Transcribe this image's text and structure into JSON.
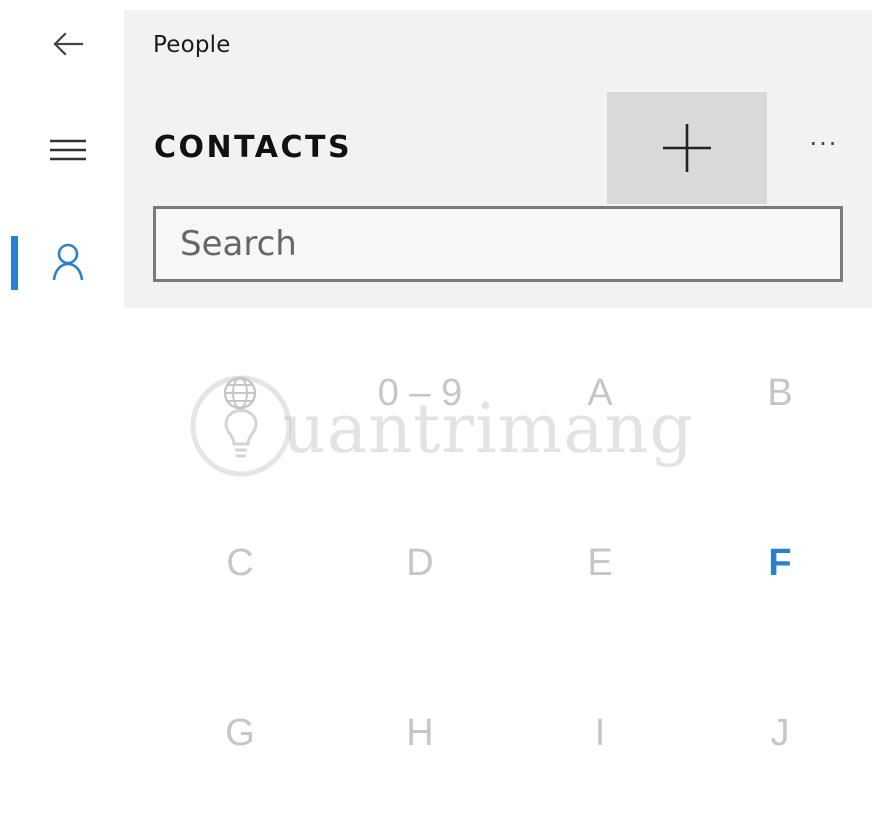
{
  "app": {
    "title": "People"
  },
  "rail": {
    "back_icon": "back-arrow-icon",
    "menu_icon": "hamburger-menu-icon",
    "people_icon": "person-icon",
    "accent_color": "#2b7fcf"
  },
  "header": {
    "section_title": "CONTACTS",
    "add_icon": "plus-icon",
    "more_label": "···"
  },
  "search": {
    "placeholder": "Search",
    "value": ""
  },
  "jump_list": {
    "letters": [
      {
        "label": "",
        "icon": "globe-icon",
        "active": false
      },
      {
        "label": "0 – 9",
        "active": false
      },
      {
        "label": "A",
        "active": false
      },
      {
        "label": "B",
        "active": false
      },
      {
        "label": "C",
        "active": false
      },
      {
        "label": "D",
        "active": false
      },
      {
        "label": "E",
        "active": false
      },
      {
        "label": "F",
        "active": true
      },
      {
        "label": "G",
        "active": false
      },
      {
        "label": "H",
        "active": false
      },
      {
        "label": "I",
        "active": false
      },
      {
        "label": "J",
        "active": false
      }
    ],
    "inactive_color": "#c6c6c6",
    "active_color": "#2b7fcf"
  },
  "watermark": {
    "text": "uantrimang",
    "icon": "lightbulb-logo-icon"
  }
}
